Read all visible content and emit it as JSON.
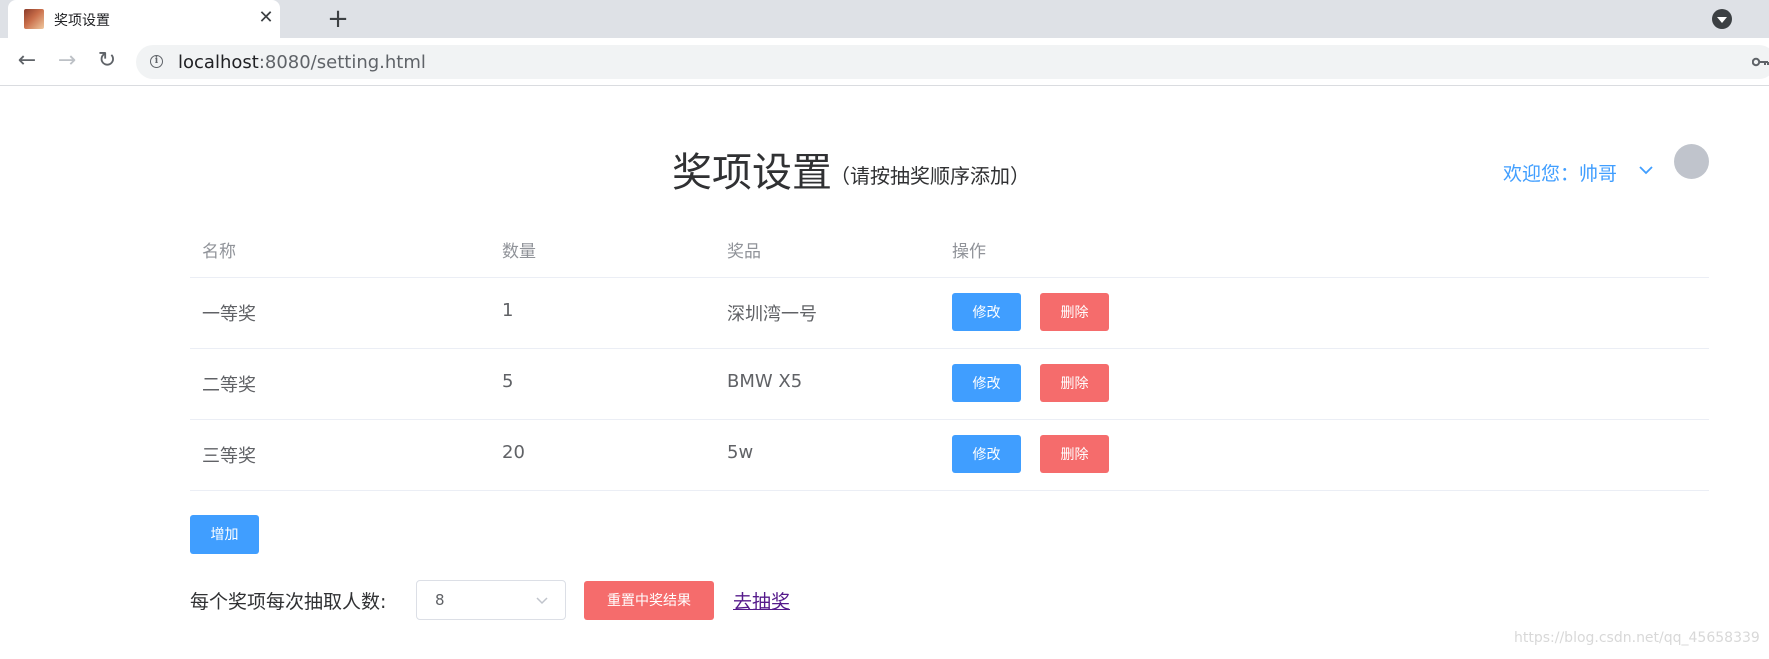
{
  "browser": {
    "tab_title": "奖项设置",
    "tab_close": "✕",
    "new_tab": "+",
    "nav_back": "←",
    "nav_forward": "→",
    "nav_reload": "↻",
    "info_glyph": "i",
    "url_host": "localhost",
    "url_rest": ":8080/setting.html"
  },
  "header": {
    "title": "奖项设置",
    "subtitle": "（请按抽奖顺序添加）",
    "welcome": "欢迎您：帅哥"
  },
  "table": {
    "columns": [
      "名称",
      "数量",
      "奖品",
      "操作"
    ],
    "rows": [
      {
        "name": "一等奖",
        "count": "1",
        "prize": "深圳湾一号"
      },
      {
        "name": "二等奖",
        "count": "5",
        "prize": "BMW X5"
      },
      {
        "name": "三等奖",
        "count": "20",
        "prize": "5w"
      }
    ],
    "edit_label": "修改",
    "delete_label": "删除"
  },
  "actions": {
    "add_label": "增加",
    "draw_count_label": "每个奖项每次抽取人数:",
    "draw_count_value": "8",
    "reset_label": "重置中奖结果",
    "go_draw_label": "去抽奖"
  },
  "watermark": "https://blog.csdn.net/qq_45658339",
  "colors": {
    "primary": "#409eff",
    "danger": "#f56c6c",
    "link_visited": "#551a8b"
  },
  "icons": {
    "favicon": "favicon-icon",
    "profile": "profile-menu-icon",
    "key": "key-icon",
    "chevron": "chevron-down-icon"
  }
}
